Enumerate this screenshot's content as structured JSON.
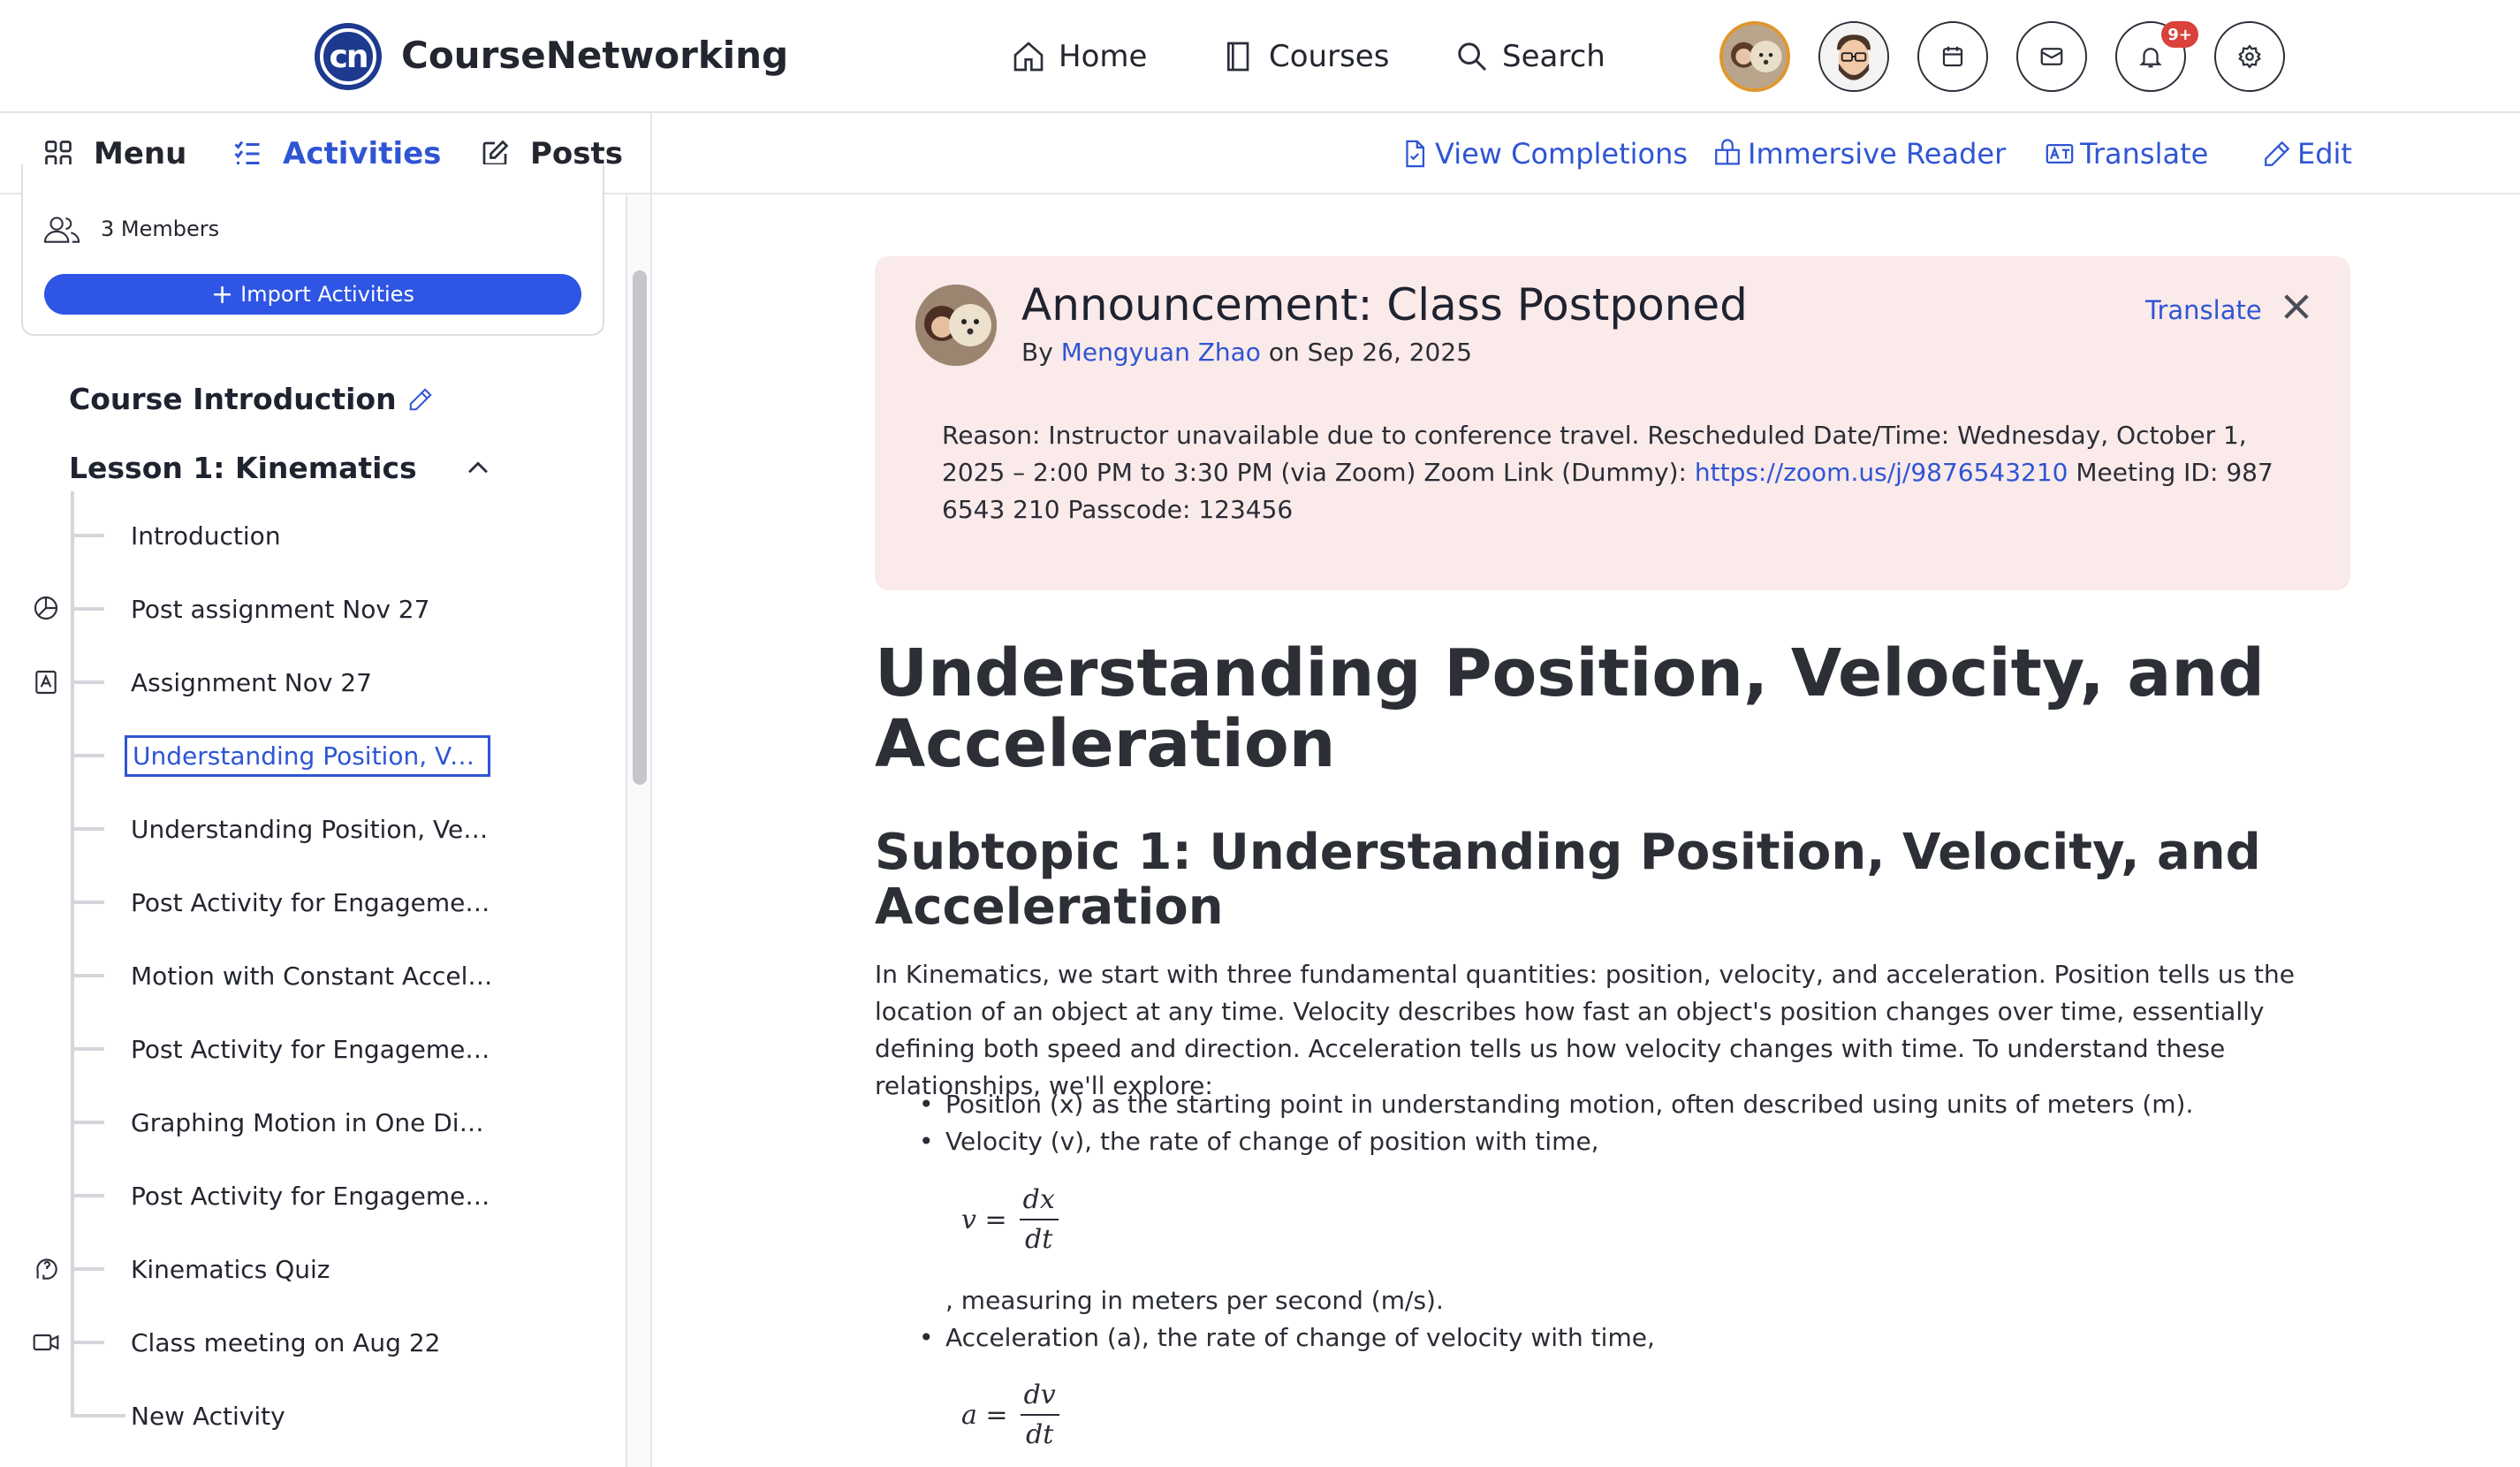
{
  "header": {
    "brand": "CourseNetworking",
    "nav": [
      {
        "label": "Home",
        "icon": "home-icon"
      },
      {
        "label": "Courses",
        "icon": "book-icon"
      },
      {
        "label": "Search",
        "icon": "search-icon"
      }
    ],
    "notification_badge": "9+",
    "logo_text": "cn"
  },
  "subnav": {
    "tabs": [
      {
        "label": "Menu",
        "icon": "grid-icon"
      },
      {
        "label": "Activities",
        "icon": "list-check-icon"
      },
      {
        "label": "Posts",
        "icon": "edit-icon"
      }
    ],
    "active_tab": "Activities",
    "actions": [
      {
        "label": "View Completions",
        "icon": "document-check-icon"
      },
      {
        "label": "Immersive Reader",
        "icon": "reader-icon"
      },
      {
        "label": "Translate",
        "icon": "translate-icon"
      },
      {
        "label": "Edit",
        "icon": "pencil-icon"
      }
    ]
  },
  "sidebar": {
    "members": "3 Members",
    "import_button": "Import Activities",
    "course_intro": "Course Introduction",
    "lesson_title": "Lesson 1: Kinematics",
    "items": [
      {
        "label": "Introduction",
        "icon": ""
      },
      {
        "label": "Post assignment Nov 27",
        "icon": "pie-chart-icon"
      },
      {
        "label": "Assignment Nov 27",
        "icon": "assignment-icon"
      },
      {
        "label": "Understanding Position, Vel...",
        "icon": "",
        "selected": true
      },
      {
        "label": "Understanding Position, Velo...",
        "icon": ""
      },
      {
        "label": "Post Activity for Engagement:...",
        "icon": ""
      },
      {
        "label": "Motion with Constant Acceler...",
        "icon": ""
      },
      {
        "label": "Post Activity for Engagement:...",
        "icon": ""
      },
      {
        "label": "Graphing Motion in One Dim...",
        "icon": ""
      },
      {
        "label": "Post Activity for Engagement:...",
        "icon": ""
      },
      {
        "label": "Kinematics Quiz",
        "icon": "quiz-icon"
      },
      {
        "label": "Class meeting on Aug 22",
        "icon": "video-icon"
      },
      {
        "label": "New Activity",
        "icon": ""
      }
    ]
  },
  "announcement": {
    "title": "Announcement: Class Postponed",
    "by_prefix": "By",
    "author": "Mengyuan Zhao",
    "date_prefix": "on",
    "date": "Sep 26, 2025",
    "translate": "Translate",
    "body_before_link": "Reason: Instructor unavailable due to conference travel. Rescheduled Date/Time: Wednesday, October 1, 2025 – 2:00 PM to 3:30 PM (via Zoom) Zoom Link (Dummy): ",
    "link": "https://zoom.us/j/9876543210",
    "body_after_link": " Meeting ID: 987 6543 210 Passcode: 123456"
  },
  "content": {
    "title": "Understanding Position, Velocity, and Acceleration",
    "subtitle": "Subtopic 1: Understanding Position, Velocity, and Acceleration",
    "intro": "In Kinematics, we start with three fundamental quantities: position, velocity, and acceleration. Position tells us the location of an object at any time. Velocity describes how fast an object's position changes over time, essentially defining both speed and direction. Acceleration tells us how velocity changes with time. To understand these relationships, we'll explore:",
    "bullets": [
      "Position (x) as the starting point in understanding motion, often described using units of meters (m).",
      "Velocity (v), the rate of change of position with time,",
      "Acceleration (a), the rate of change of velocity with time,"
    ],
    "velocity_formula": {
      "lhs": "v =",
      "num": "dx",
      "den": "dt"
    },
    "velocity_units": ", measuring in meters per second (m/s).",
    "acceleration_formula": {
      "lhs": "a =",
      "num": "dv",
      "den": "dt"
    }
  },
  "colors": {
    "accent": "#2f55d4",
    "announcement_bg": "#fbeaea",
    "badge": "#d9413a",
    "import_button": "#2f55e4"
  }
}
